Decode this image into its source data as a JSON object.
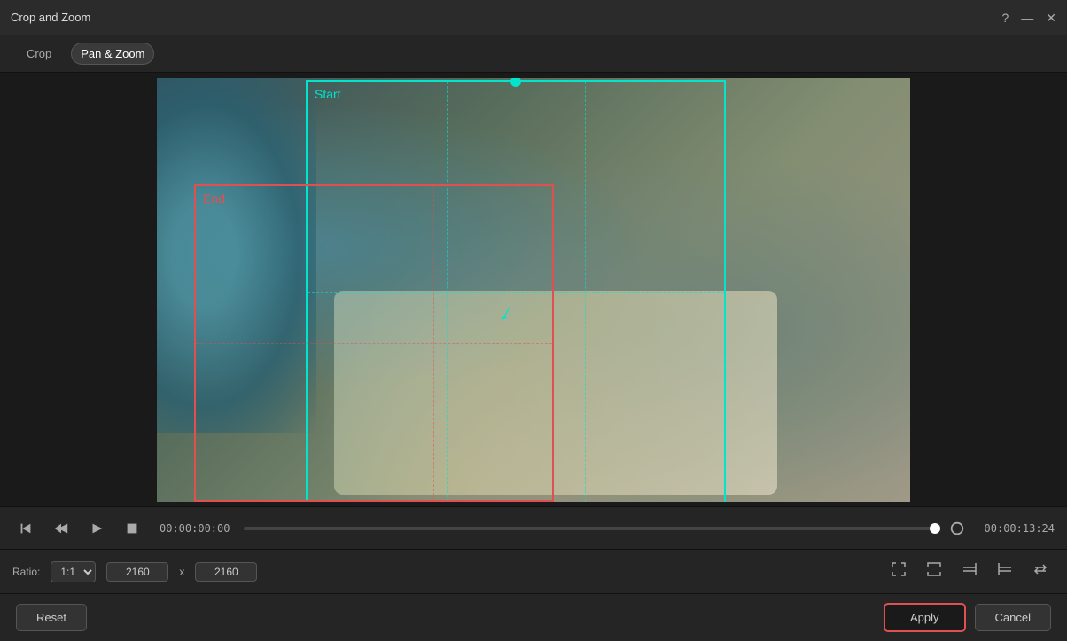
{
  "window": {
    "title": "Crop and Zoom"
  },
  "tabs": {
    "crop_label": "Crop",
    "pan_zoom_label": "Pan & Zoom",
    "active": "pan_zoom"
  },
  "video": {
    "start_label": "Start",
    "end_label": "End",
    "current_time": "00:00:00:00",
    "end_time": "00:00:13:24"
  },
  "settings": {
    "ratio_label": "Ratio:",
    "ratio_value": "1:1",
    "width": "2160",
    "height": "2160"
  },
  "footer": {
    "reset_label": "Reset",
    "apply_label": "Apply",
    "cancel_label": "Cancel"
  },
  "title_bar_controls": {
    "help": "?",
    "minimize": "—",
    "close": "✕"
  }
}
